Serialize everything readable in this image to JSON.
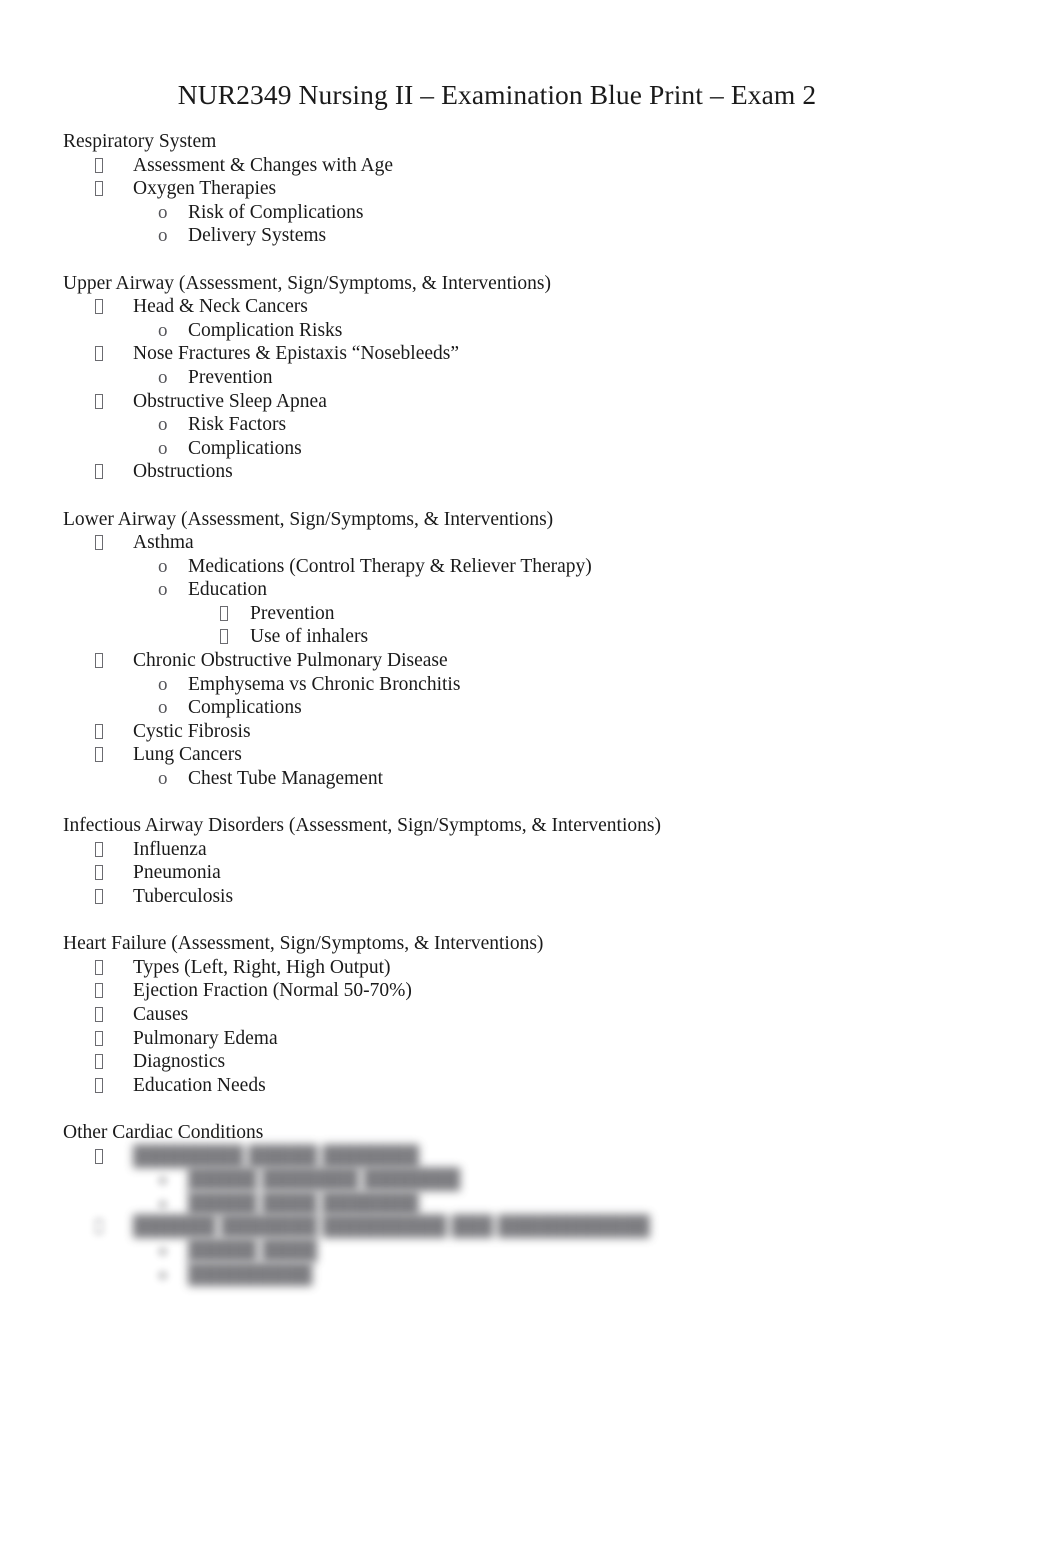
{
  "document": {
    "title": "NUR2349 Nursing II – Examination Blue Print – Exam 2",
    "markers": {
      "level1": "□",
      "level2": "o",
      "level3": "□"
    },
    "sections": [
      {
        "heading": "Respiratory System",
        "items": [
          {
            "level": 1,
            "text": "Assessment & Changes with Age"
          },
          {
            "level": 1,
            "text": "Oxygen Therapies"
          },
          {
            "level": 2,
            "text": "Risk of Complications"
          },
          {
            "level": 2,
            "text": "Delivery Systems"
          }
        ]
      },
      {
        "heading": "Upper Airway (Assessment, Sign/Symptoms, & Interventions)",
        "items": [
          {
            "level": 1,
            "text": "Head & Neck Cancers"
          },
          {
            "level": 2,
            "text": "Complication Risks"
          },
          {
            "level": 1,
            "text": "Nose Fractures &  Epistaxis “Nosebleeds”"
          },
          {
            "level": 2,
            "text": "Prevention"
          },
          {
            "level": 1,
            "text": "Obstructive Sleep Apnea"
          },
          {
            "level": 2,
            "text": "Risk Factors"
          },
          {
            "level": 2,
            "text": "Complications"
          },
          {
            "level": 1,
            "text": "Obstructions"
          }
        ]
      },
      {
        "heading": "Lower Airway (Assessment, Sign/Symptoms, & Interventions)",
        "items": [
          {
            "level": 1,
            "text": "Asthma"
          },
          {
            "level": 2,
            "text": "Medications (Control Therapy & Reliever Therapy)"
          },
          {
            "level": 2,
            "text": "Education"
          },
          {
            "level": 3,
            "text": "Prevention"
          },
          {
            "level": 3,
            "text": "Use of inhalers"
          },
          {
            "level": 1,
            "text": "Chronic Obstructive Pulmonary Disease"
          },
          {
            "level": 2,
            "text": "Emphysema vs Chronic Bronchitis"
          },
          {
            "level": 2,
            "text": "Complications"
          },
          {
            "level": 1,
            "text": "Cystic Fibrosis"
          },
          {
            "level": 1,
            "text": "Lung Cancers"
          },
          {
            "level": 2,
            "text": "Chest Tube Management"
          }
        ]
      },
      {
        "heading": "Infectious Airway Disorders (Assessment, Sign/Symptoms, & Interventions)",
        "items": [
          {
            "level": 1,
            "text": "Influenza"
          },
          {
            "level": 1,
            "text": "Pneumonia"
          },
          {
            "level": 1,
            "text": "Tuberculosis"
          }
        ]
      },
      {
        "heading": "Heart Failure (Assessment, Sign/Symptoms, & Interventions)",
        "items": [
          {
            "level": 1,
            "text": "Types (Left, Right, High Output)"
          },
          {
            "level": 1,
            "text": "Ejection Fraction (Normal 50-70%)"
          },
          {
            "level": 1,
            "text": "Causes"
          },
          {
            "level": 1,
            "text": "Pulmonary Edema"
          },
          {
            "level": 1,
            "text": "Diagnostics"
          },
          {
            "level": 1,
            "text": "Education Needs"
          }
        ]
      }
    ],
    "redacted_section": {
      "heading": "Other Cardiac Conditions",
      "items": [
        {
          "level": 1,
          "text": "████████ █████ ███████",
          "marker_blurred": false
        },
        {
          "level": 2,
          "text": "█████ ███████ ███████",
          "marker_blurred": true
        },
        {
          "level": 2,
          "text": "█████ ████ ███████",
          "marker_blurred": true
        },
        {
          "level": 1,
          "text": "██████ ███████ █████████ ███ ███████████",
          "marker_blurred": true
        },
        {
          "level": 2,
          "text": "█████ ████",
          "marker_blurred": true
        },
        {
          "level": 2,
          "text": "█████████",
          "marker_blurred": true
        }
      ]
    }
  }
}
